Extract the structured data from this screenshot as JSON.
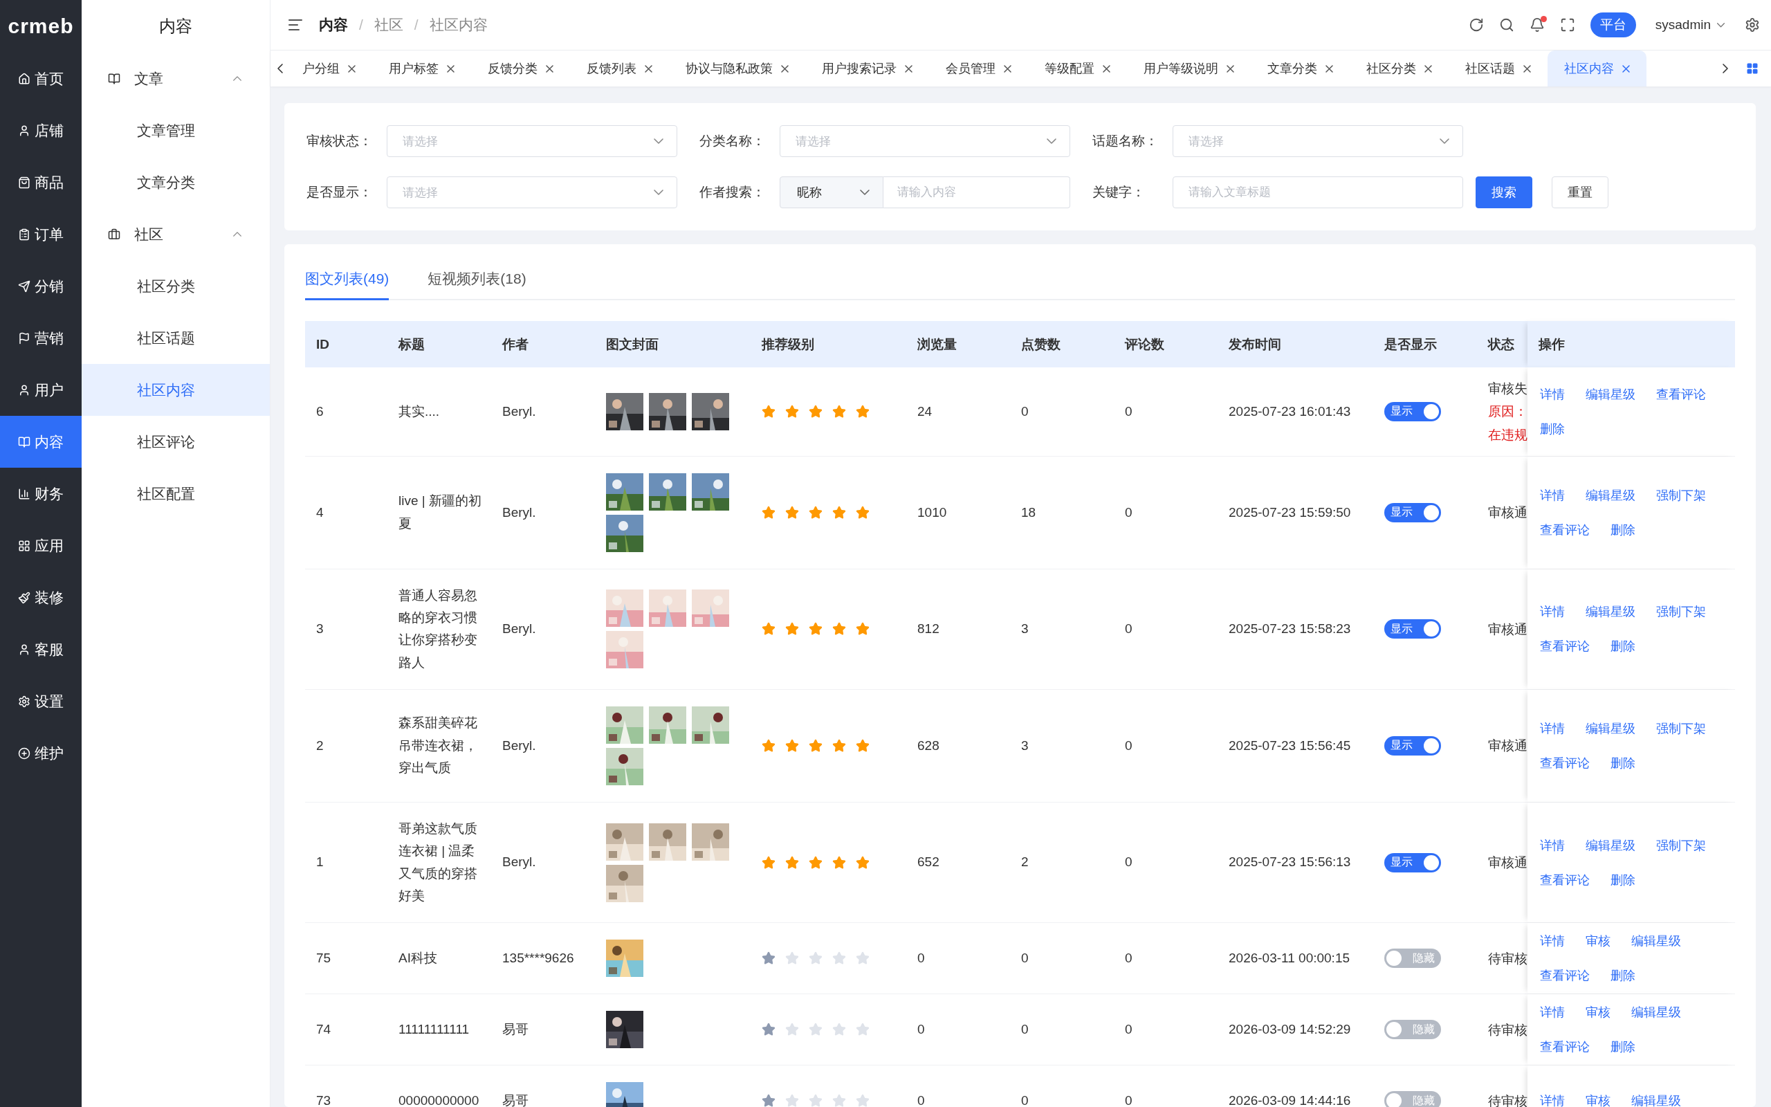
{
  "logo": "crmeb",
  "main_nav": [
    {
      "label": "首页",
      "selected": false
    },
    {
      "label": "店铺",
      "selected": false
    },
    {
      "label": "商品",
      "selected": false
    },
    {
      "label": "订单",
      "selected": false
    },
    {
      "label": "分销",
      "selected": false
    },
    {
      "label": "营销",
      "selected": false
    },
    {
      "label": "用户",
      "selected": false
    },
    {
      "label": "内容",
      "selected": true
    },
    {
      "label": "财务",
      "selected": false
    },
    {
      "label": "应用",
      "selected": false
    },
    {
      "label": "装修",
      "selected": false
    },
    {
      "label": "客服",
      "selected": false
    },
    {
      "label": "设置",
      "selected": false
    },
    {
      "label": "维护",
      "selected": false
    }
  ],
  "sub_nav": {
    "title": "内容",
    "groups": [
      {
        "label": "文章",
        "expanded": true,
        "children": [
          {
            "label": "文章管理",
            "selected": false
          },
          {
            "label": "文章分类",
            "selected": false
          }
        ]
      },
      {
        "label": "社区",
        "expanded": true,
        "children": [
          {
            "label": "社区分类",
            "selected": false
          },
          {
            "label": "社区话题",
            "selected": false
          },
          {
            "label": "社区内容",
            "selected": true
          },
          {
            "label": "社区评论",
            "selected": false
          },
          {
            "label": "社区配置",
            "selected": false
          }
        ]
      }
    ]
  },
  "breadcrumb": [
    "内容",
    "/",
    "社区",
    "/",
    "社区内容"
  ],
  "header": {
    "platform_button": "平台",
    "user": "sysadmin",
    "notification_dot": true
  },
  "page_tabs": [
    {
      "label": "户分组",
      "selected": false
    },
    {
      "label": "用户标签",
      "selected": false
    },
    {
      "label": "反馈分类",
      "selected": false
    },
    {
      "label": "反馈列表",
      "selected": false
    },
    {
      "label": "协议与隐私政策",
      "selected": false
    },
    {
      "label": "用户搜索记录",
      "selected": false
    },
    {
      "label": "会员管理",
      "selected": false
    },
    {
      "label": "等级配置",
      "selected": false
    },
    {
      "label": "用户等级说明",
      "selected": false
    },
    {
      "label": "文章分类",
      "selected": false
    },
    {
      "label": "社区分类",
      "selected": false
    },
    {
      "label": "社区话题",
      "selected": false
    },
    {
      "label": "社区内容",
      "selected": true
    }
  ],
  "filters": [
    {
      "kind": "select",
      "label": "审核状态：",
      "placeholder": "请选择"
    },
    {
      "kind": "select",
      "label": "分类名称：",
      "placeholder": "请选择"
    },
    {
      "kind": "select",
      "label": "话题名称：",
      "placeholder": "请选择"
    },
    {
      "kind": "select",
      "label": "是否显示：",
      "placeholder": "请选择"
    },
    {
      "kind": "combo",
      "label": "作者搜索：",
      "value": "昵称",
      "placeholder": "请输入内容"
    },
    {
      "kind": "input",
      "label": "关键字：",
      "placeholder": "请输入文章标题"
    }
  ],
  "filter_buttons": [
    {
      "label": "搜索",
      "kind": "primary"
    },
    {
      "label": "重置",
      "kind": "default"
    }
  ],
  "list_tabs": [
    {
      "label": "图文列表(49)",
      "selected": true
    },
    {
      "label": "短视频列表(18)",
      "selected": false
    }
  ],
  "table": {
    "columns": [
      "ID",
      "标题",
      "作者",
      "图文封面",
      "推荐级别",
      "浏览量",
      "点赞数",
      "评论数",
      "发布时间",
      "是否显示",
      "状态",
      "操作"
    ],
    "rows": [
      {
        "id": "6",
        "title": "其实....",
        "author": "Beryl.",
        "covers": [
          {
            "kind": "picture"
          },
          {
            "kind": "picture"
          },
          {
            "kind": "picture"
          }
        ],
        "stars": 5,
        "rating_disabled": false,
        "views": "24",
        "likes": "0",
        "comments": "0",
        "time": "2025-07-23 16:01:43",
        "show": true,
        "show_label": "显示",
        "status": [
          {
            "text": "审核失",
            "kind": "normal"
          },
          {
            "text": "原因：",
            "kind": "error"
          },
          {
            "text": "在违规",
            "kind": "error"
          }
        ],
        "actions": [
          "详情",
          "编辑星级",
          "查看评论",
          "删除"
        ]
      },
      {
        "id": "4",
        "title": "live | 新疆的初夏",
        "author": "Beryl.",
        "covers": [
          {
            "kind": "picture"
          },
          {
            "kind": "picture"
          },
          {
            "kind": "picture"
          },
          {
            "kind": "picture"
          }
        ],
        "stars": 5,
        "rating_disabled": false,
        "views": "1010",
        "likes": "18",
        "comments": "0",
        "time": "2025-07-23 15:59:50",
        "show": true,
        "show_label": "显示",
        "status": [
          {
            "text": "审核通",
            "kind": "normal"
          }
        ],
        "actions": [
          "详情",
          "编辑星级",
          "强制下架",
          "查看评论",
          "删除"
        ]
      },
      {
        "id": "3",
        "title": "普通人容易忽略的穿衣习惯让你穿搭秒变路人",
        "author": "Beryl.",
        "covers": [
          {
            "kind": "picture"
          },
          {
            "kind": "picture"
          },
          {
            "kind": "picture"
          },
          {
            "kind": "picture"
          }
        ],
        "stars": 5,
        "rating_disabled": false,
        "views": "812",
        "likes": "3",
        "comments": "0",
        "time": "2025-07-23 15:58:23",
        "show": true,
        "show_label": "显示",
        "status": [
          {
            "text": "审核通",
            "kind": "normal"
          }
        ],
        "actions": [
          "详情",
          "编辑星级",
          "强制下架",
          "查看评论",
          "删除"
        ]
      },
      {
        "id": "2",
        "title": "森系甜美碎花吊带连衣裙，穿出气质",
        "author": "Beryl.",
        "covers": [
          {
            "kind": "picture"
          },
          {
            "kind": "picture"
          },
          {
            "kind": "picture"
          },
          {
            "kind": "picture"
          }
        ],
        "stars": 5,
        "rating_disabled": false,
        "views": "628",
        "likes": "3",
        "comments": "0",
        "time": "2025-07-23 15:56:45",
        "show": true,
        "show_label": "显示",
        "status": [
          {
            "text": "审核通",
            "kind": "normal"
          }
        ],
        "actions": [
          "详情",
          "编辑星级",
          "强制下架",
          "查看评论",
          "删除"
        ]
      },
      {
        "id": "1",
        "title": "哥弟这款气质连衣裙 | 温柔又气质的穿搭好美",
        "author": "Beryl.",
        "covers": [
          {
            "kind": "picture"
          },
          {
            "kind": "picture"
          },
          {
            "kind": "picture"
          },
          {
            "kind": "picture"
          }
        ],
        "stars": 5,
        "rating_disabled": false,
        "views": "652",
        "likes": "2",
        "comments": "0",
        "time": "2025-07-23 15:56:13",
        "show": true,
        "show_label": "显示",
        "status": [
          {
            "text": "审核通",
            "kind": "normal"
          }
        ],
        "actions": [
          "详情",
          "编辑星级",
          "强制下架",
          "查看评论",
          "删除"
        ]
      },
      {
        "id": "75",
        "title": "AI科技",
        "author": "135****9626",
        "covers": [
          {
            "kind": "picture"
          }
        ],
        "stars": 1,
        "rating_disabled": true,
        "views": "0",
        "likes": "0",
        "comments": "0",
        "time": "2026-03-11 00:00:15",
        "show": false,
        "show_label": "隐藏",
        "status": [
          {
            "text": "待审核",
            "kind": "normal"
          }
        ],
        "actions": [
          "详情",
          "审核",
          "编辑星级",
          "查看评论",
          "删除"
        ]
      },
      {
        "id": "74",
        "title": "11111111111",
        "author": "易哥",
        "covers": [
          {
            "kind": "picture"
          }
        ],
        "stars": 1,
        "rating_disabled": true,
        "views": "0",
        "likes": "0",
        "comments": "0",
        "time": "2026-03-09 14:52:29",
        "show": false,
        "show_label": "隐藏",
        "status": [
          {
            "text": "待审核",
            "kind": "normal"
          }
        ],
        "actions": [
          "详情",
          "审核",
          "编辑星级",
          "查看评论",
          "删除"
        ]
      },
      {
        "id": "73",
        "title": "00000000000",
        "author": "易哥",
        "covers": [
          {
            "kind": "picture"
          }
        ],
        "stars": 1,
        "rating_disabled": true,
        "views": "0",
        "likes": "0",
        "comments": "0",
        "time": "2026-03-09 14:44:16",
        "show": false,
        "show_label": "隐藏",
        "status": [
          {
            "text": "待审核",
            "kind": "normal"
          }
        ],
        "actions": [
          "详情",
          "审核",
          "编辑星级"
        ]
      }
    ]
  }
}
